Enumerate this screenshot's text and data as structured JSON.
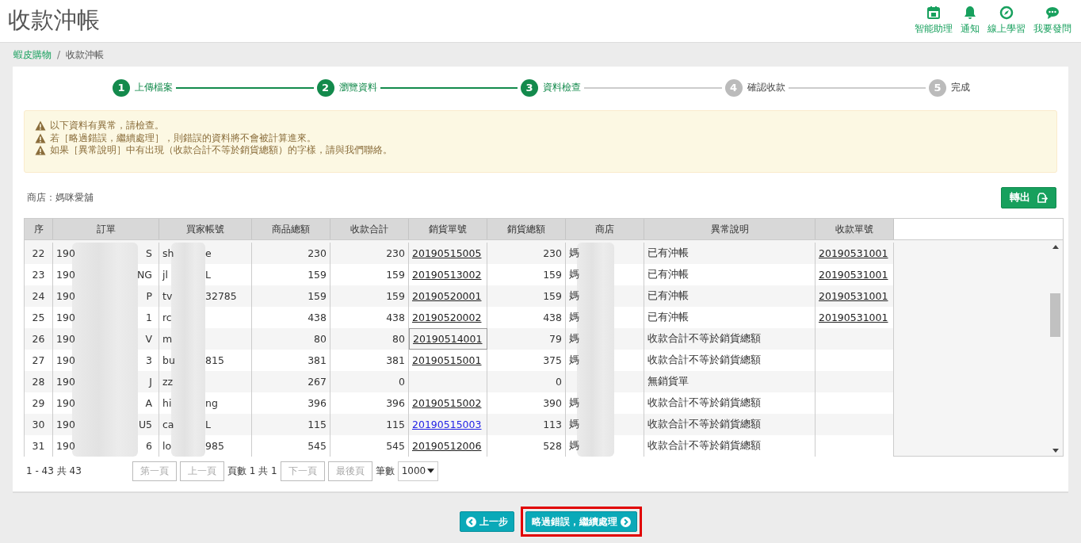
{
  "page_title": "收款沖帳",
  "header_actions": [
    {
      "kind": "calendar",
      "label": "智能助理"
    },
    {
      "kind": "bell",
      "label": "通知"
    },
    {
      "kind": "compass",
      "label": "線上學習"
    },
    {
      "kind": "chat",
      "label": "我要發問"
    }
  ],
  "breadcrumb": [
    {
      "label": "蝦皮購物",
      "link": true
    },
    {
      "label": "收款沖帳",
      "link": false
    }
  ],
  "breadcrumb_separator": "/",
  "steps": [
    {
      "number": "1",
      "label": "上傳檔案",
      "completed": true
    },
    {
      "number": "2",
      "label": "瀏覽資料",
      "completed": true
    },
    {
      "number": "3",
      "label": "資料檢查",
      "completed": true
    },
    {
      "number": "4",
      "label": "確認收款",
      "completed": false
    },
    {
      "number": "5",
      "label": "完成",
      "completed": false
    }
  ],
  "alerts": [
    "以下資料有異常，請檢查。",
    "若［略過錯誤，繼續處理］，則錯誤的資料將不會被計算進來。",
    "如果［異常說明］中有出現（收款合計不等於銷貨總額）的字樣，請與我們聯絡。"
  ],
  "store_label": "商店：媽咪愛舖",
  "export_button": "轉出",
  "table": {
    "columns": [
      "序",
      "訂單",
      "買家帳號",
      "商品總額",
      "收款合計",
      "銷貨單號",
      "銷貨總額",
      "商店",
      "異常說明",
      "收款單號"
    ],
    "rows": [
      {
        "no": "22",
        "order_start": "190",
        "order_end": "S",
        "buyer_start": "sh",
        "buyer_end": "e",
        "goods_total": "230",
        "received": "230",
        "sales_no": "20190515005",
        "sales_no_visited": false,
        "sales_no_focused": false,
        "sales_total": "230",
        "store": "媽",
        "note": "已有沖帳",
        "receipt_no": "20190531001"
      },
      {
        "no": "23",
        "order_start": "190",
        "order_end": "NG",
        "buyer_start": "jl",
        "buyer_end": "L",
        "goods_total": "159",
        "received": "159",
        "sales_no": "20190513002",
        "sales_no_visited": false,
        "sales_no_focused": false,
        "sales_total": "159",
        "store": "媽",
        "note": "已有沖帳",
        "receipt_no": "20190531001"
      },
      {
        "no": "24",
        "order_start": "190",
        "order_end": "P",
        "buyer_start": "tv",
        "buyer_end": "32785",
        "goods_total": "159",
        "received": "159",
        "sales_no": "20190520001",
        "sales_no_visited": false,
        "sales_no_focused": false,
        "sales_total": "159",
        "store": "媽",
        "note": "已有沖帳",
        "receipt_no": "20190531001"
      },
      {
        "no": "25",
        "order_start": "190",
        "order_end": "1",
        "buyer_start": "rc",
        "goods_total": "438",
        "received": "438",
        "sales_no": "20190520002",
        "sales_no_visited": false,
        "sales_no_focused": false,
        "sales_total": "438",
        "store": "媽",
        "note": "已有沖帳",
        "receipt_no": "20190531001"
      },
      {
        "no": "26",
        "order_start": "190",
        "order_end": "V",
        "buyer_start": "m",
        "goods_total": "80",
        "received": "80",
        "sales_no": "20190514001",
        "sales_no_visited": false,
        "sales_no_focused": true,
        "sales_total": "79",
        "store": "媽",
        "note": "收款合計不等於銷貨總額"
      },
      {
        "no": "27",
        "order_start": "190",
        "order_end": "3",
        "buyer_start": "bu",
        "buyer_end": "815",
        "goods_total": "381",
        "received": "381",
        "sales_no": "20190515001",
        "sales_no_visited": false,
        "sales_no_focused": false,
        "sales_total": "375",
        "store": "媽",
        "note": "收款合計不等於銷貨總額"
      },
      {
        "no": "28",
        "order_start": "190",
        "order_end": "J",
        "buyer_start": "zz",
        "goods_total": "267",
        "received": "0",
        "sales_no_focused": false,
        "sales_total": "0",
        "note": "無銷貨單"
      },
      {
        "no": "29",
        "order_start": "190",
        "order_end": "A",
        "buyer_start": "hi",
        "buyer_end": "ng",
        "goods_total": "396",
        "received": "396",
        "sales_no": "20190515002",
        "sales_no_visited": false,
        "sales_no_focused": false,
        "sales_total": "390",
        "store": "媽",
        "note": "收款合計不等於銷貨總額"
      },
      {
        "no": "30",
        "order_start": "190",
        "order_end": "U5",
        "buyer_start": "ca",
        "buyer_end": "L",
        "goods_total": "115",
        "received": "115",
        "sales_no": "20190515003",
        "sales_no_visited": true,
        "sales_no_focused": false,
        "sales_total": "113",
        "store": "媽",
        "note": "收款合計不等於銷貨總額"
      },
      {
        "no": "31",
        "order_start": "190",
        "order_end": "6",
        "buyer_start": "lo",
        "buyer_end": "985",
        "goods_total": "545",
        "received": "545",
        "sales_no": "20190512006",
        "sales_no_visited": false,
        "sales_no_focused": false,
        "sales_total": "528",
        "store": "媽",
        "note": "收款合計不等於銷貨總額"
      }
    ]
  },
  "pager": {
    "range": "1 - 43 共 43",
    "first": "第一頁",
    "prev": "上一頁",
    "page_info": "頁數 1 共 1",
    "next": "下一頁",
    "last": "最後頁",
    "size_label": "筆數",
    "size": "1000"
  },
  "footer_buttons": [
    {
      "kind": "back",
      "label": "上一步",
      "highlighted": false
    },
    {
      "kind": "forward",
      "label": "略過錯誤，繼續處理",
      "highlighted": true
    }
  ]
}
